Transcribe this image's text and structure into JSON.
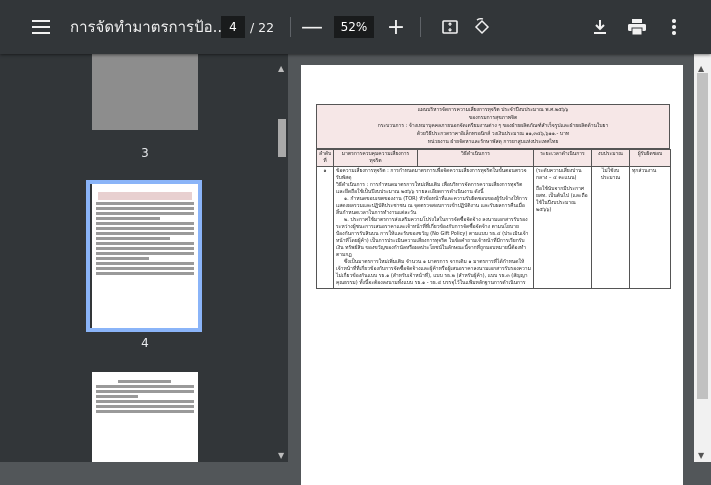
{
  "toolbar": {
    "title": "การจัดทำมาตรการป้อ...",
    "current_page": "4",
    "total_pages": "/ 22",
    "zoom_minus": "—",
    "zoom": "52%",
    "zoom_plus": "+"
  },
  "thumbnails": [
    {
      "label": "3"
    },
    {
      "label": "4",
      "selected": true
    }
  ],
  "document": {
    "header": [
      "แผนบริหารจัดการความเสี่ยงการทุจริต ประจำปีงบประมาณ พ.ศ.๒๕๖๖",
      "ของกรมการสุขภาพจิต",
      "กระบวนการ : จ้างเหมาบุคคลภายนอกจัดเตรียมงานต่าง ๆ ของฝ่ายผลิตภัณฑ์สำเร็จรูปและฝ่ายผลิตด้านใบยา",
      "ด้วยวิธีประกวดราคาอิเล็กทรอนิกส์ วงเงินประมาณ ๑๑,๓๔๖,๖๑๑.- บาท",
      "หน่วยงาน ฝ่ายจัดหาและรักษาพัสดุ การยาสูบแห่งประเทศไทย"
    ],
    "columns": [
      "ลำดับที่",
      "มาตรการควบคุมความเสี่ยงการทุจริต",
      "วิธีดำเนินการ",
      "ระยะเวลาดำเนินการ",
      "งบประมาณ",
      "ผู้รับผิดชอบ"
    ],
    "row": {
      "no": "๑",
      "measure": "ข้อความเสี่ยงการทุจริต : การกำหนดมาตรการเพื่อจัดความเสี่ยงการทุจริตในขั้นตอนตรวจรับพัสดุ",
      "method_1": "วิธีดำเนินการ : การกำหนดมาตรการใหม่เพิ่มเติม เพื่อบริหารจัดการความเสี่ยงการทุจริต และยึดถือใช้เป็นปีงบประมาณ ๒๕๖๖ รายละเอียดการดำเนินงาน ดังนี้",
      "method_2": "๑. กำหนดขอบเขตของงาน (TOR) หัวข้อหน้าที่และความรับผิดชอบของผู้รับจ้างให้การแสดงผลรวมและปฏิบัติประชาชน ณ จุดตรวจสอบการเข้าปฏิบัติงาน และรับผลการคืนเมื่อสิ้นกำหนดเวลาในการทำงานแต่ละวัน",
      "method_3": "๒. ประกาศใช้มาตรการส่งเสริมความโปร่งใสในการจัดซื้อจัดจ้าง ลงนามเอกสารรับรองระหว่างผู้ชนะการเสนอราคาและเจ้าหน้าที่ที่เกี่ยวข้องกับการจัดซื้อจัดจ้าง ตามนโยบายป้องกันการรับสินบน การให้และรับของขวัญ (No Gift Policy) ตามแบบ รธ.๔ (ประเมินเจ้าหน้าที่โดยผู้ค้า) เป็นการประเมินความเสี่ยงการทุจริต ในข้อคำถามเจ้าหน้าที่มีการเรียกรับเงิน ทรัพย์สิน ของขวัญของกำนัลหรือผลประโยชน์ในลักษณะนี้จากที่ถูกมอบหมายนี้ต้องทำตามกฏ ",
      "method_4": "ซึ่งเป็นมาตรการใหม่เพิ่มเติม จำนวน ๑ มาตรการ จากเดิม ๑ มาตรการที่ได้กำหนดให้เจ้าหน้าที่ที่เกี่ยวข้องกับการจัดซื้อจัดจ้างและผู้ค้าหรือผู้เสนอราคาลงนามเอกสารรับรองความไม่เกี่ยวข้องกันแบบ รธ.๑ (สำหรับเจ้าหน้าที่), แบบ รธ.๒ (สำหรับผู้ค้า), แบบ รธ.๓ (สัญญาคุณธรรม) ทั้งนี้จะต้องลงนามทั้งแบบ รธ.๑ - รธ.๔ บรรจุไว้ในแฟ้มหลักฐานการดำเนินการ",
      "period": "(ระดับความเสี่ยงปานกลาง – ๔ คะแนน)",
      "period_2": "ถือใช้นับจากมีประกาศ ยสท. เป็นต้นไป (และถือใช้ในปีงบประมาณ ๒๕๖๖)",
      "budget": "ไม่ใช้งบประมาณ",
      "owner": "ทุกส่วนงาน"
    }
  }
}
